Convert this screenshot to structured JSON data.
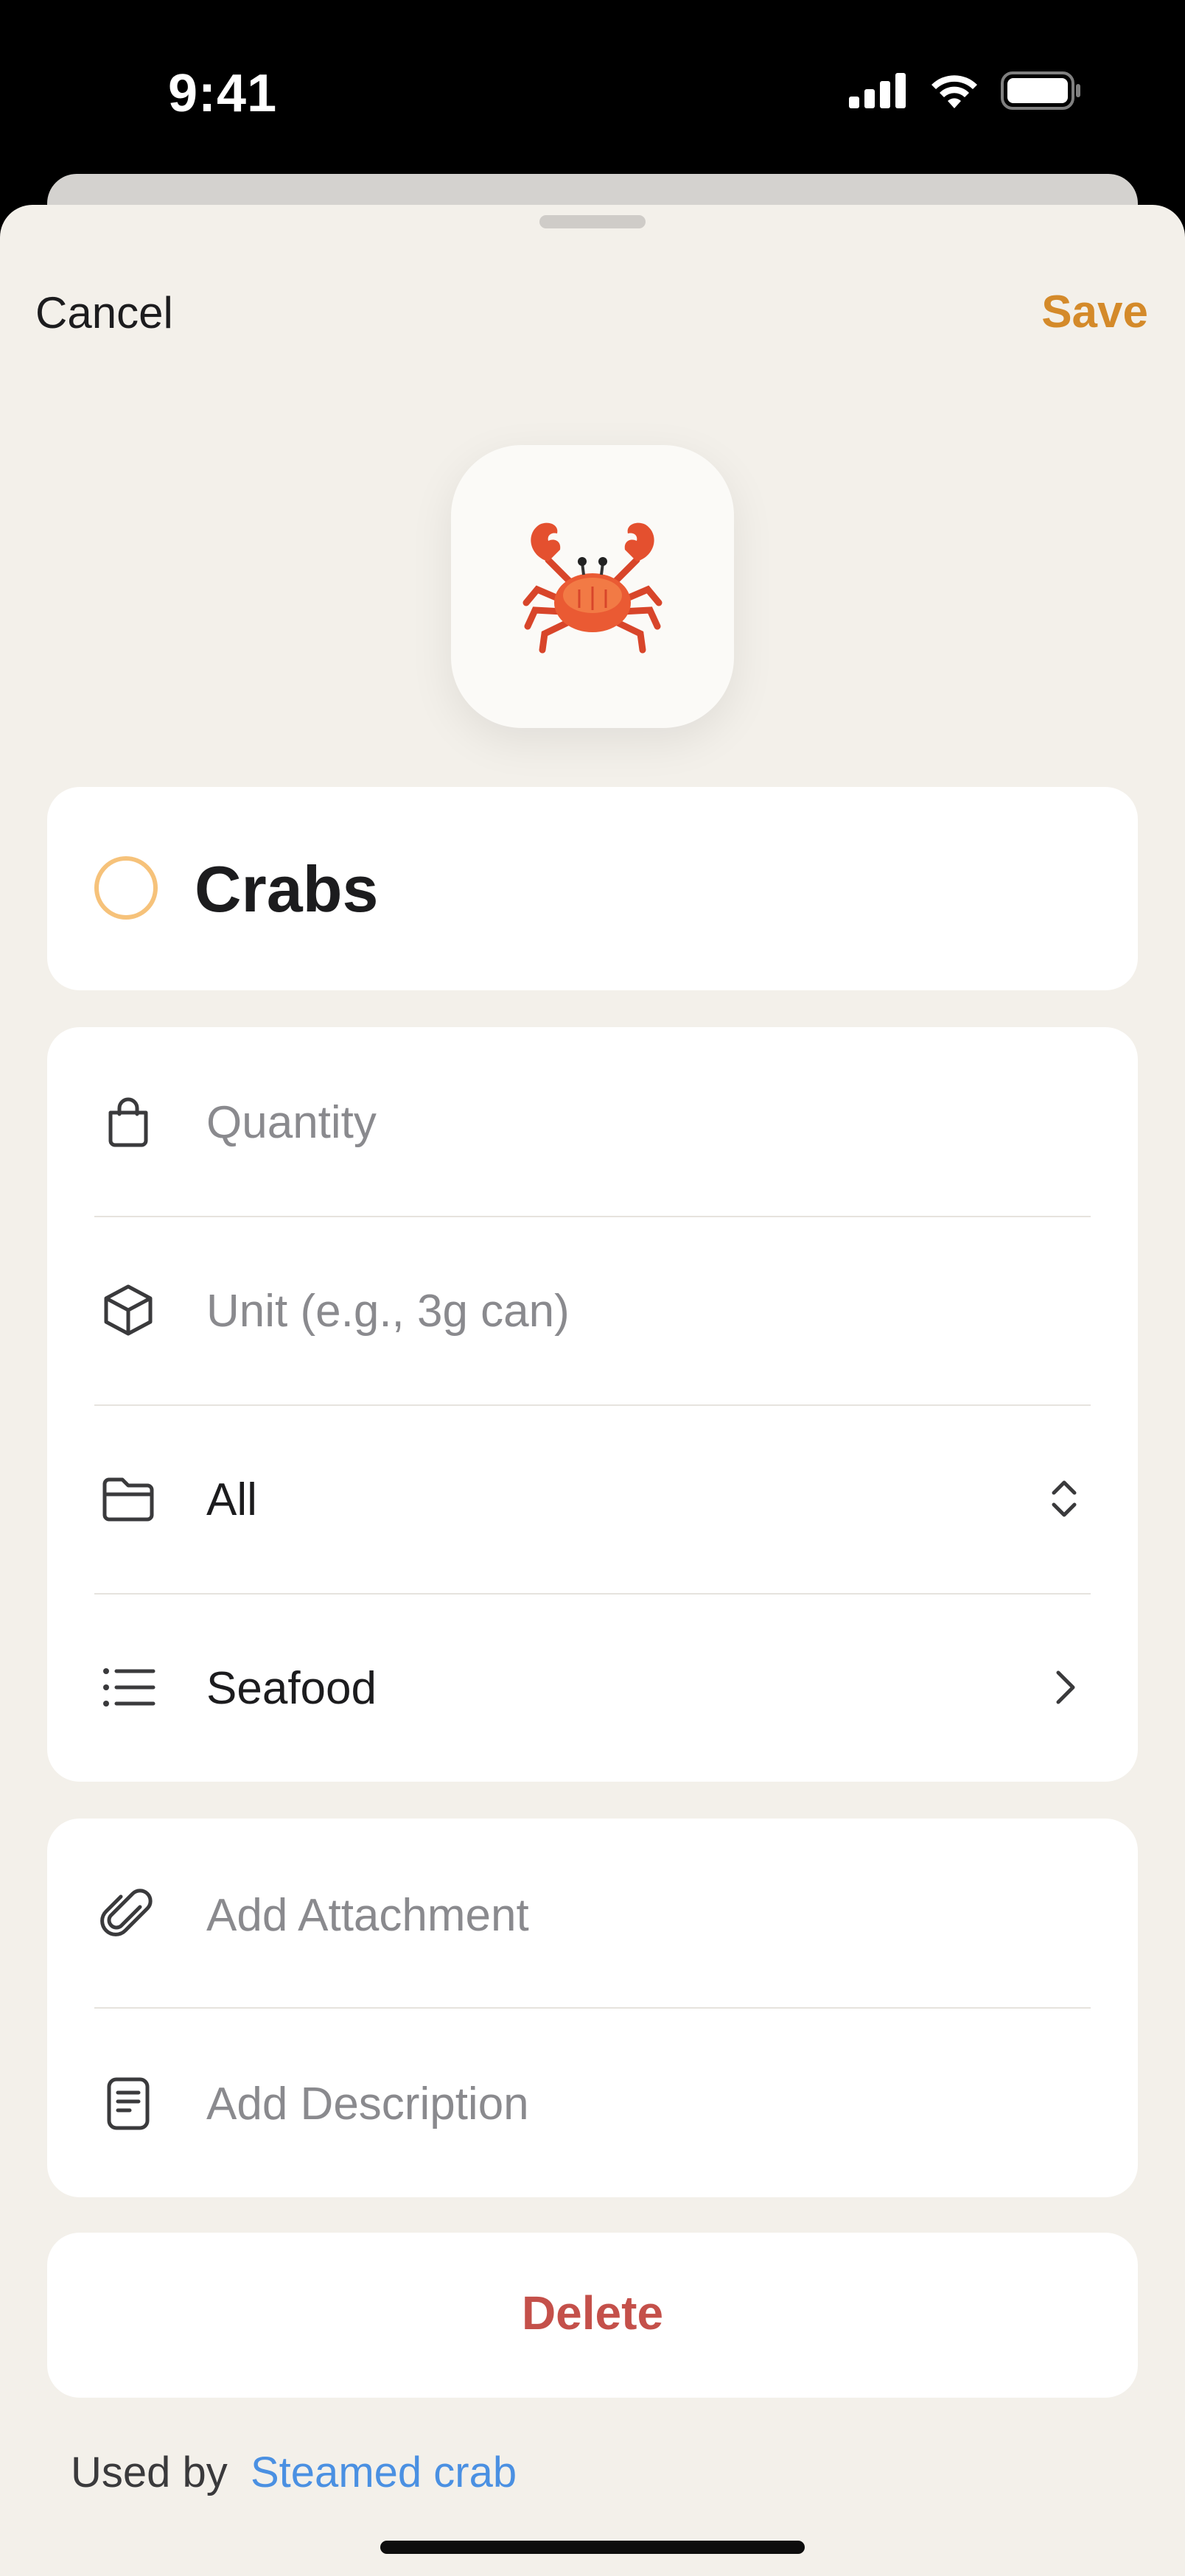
{
  "status_bar": {
    "time": "9:41"
  },
  "nav": {
    "cancel_label": "Cancel",
    "save_label": "Save"
  },
  "item": {
    "emoji_icon": "crab-emoji",
    "title": "Crabs"
  },
  "details": {
    "quantity_placeholder": "Quantity",
    "unit_placeholder": "Unit (e.g., 3g can)",
    "folder_value": "All",
    "category_value": "Seafood"
  },
  "extras": {
    "attachment_label": "Add Attachment",
    "description_label": "Add Description"
  },
  "actions": {
    "delete_label": "Delete"
  },
  "footer": {
    "used_by_label": "Used by",
    "used_by_link": "Steamed crab"
  },
  "colors": {
    "accent": "#d48a2a",
    "destructive": "#c4504a",
    "link": "#4a90e2",
    "background": "#f3f0ea"
  }
}
